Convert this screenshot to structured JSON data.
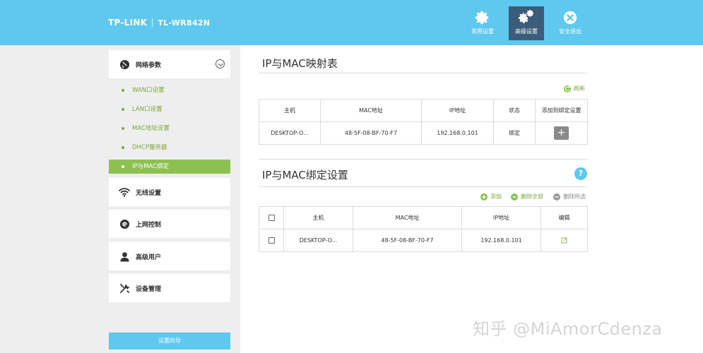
{
  "header": {
    "brand": "TP-LINK",
    "model": "TL-WR842N",
    "nav": [
      {
        "label": "常用设置",
        "icon": "gear-icon"
      },
      {
        "label": "高级设置",
        "icon": "gears-icon"
      },
      {
        "label": "安全退出",
        "icon": "close-circle-icon"
      }
    ],
    "active_nav": "高级设置"
  },
  "sidebar": {
    "network": {
      "label": "网络参数",
      "icon": "globe-icon"
    },
    "sub_items": [
      "WAN口设置",
      "LAN口设置",
      "MAC地址设置",
      "DHCP服务器",
      "IP与MAC绑定"
    ],
    "active_sub": "IP与MAC绑定",
    "wireless": {
      "label": "无线设置",
      "icon": "wifi-icon"
    },
    "internet": {
      "label": "上网控制",
      "icon": "internet-e-icon"
    },
    "admin_user": {
      "label": "高级用户",
      "icon": "user-icon"
    },
    "device": {
      "label": "设备管理",
      "icon": "tools-icon"
    },
    "wizard": "设置向导"
  },
  "mapping": {
    "title": "IP与MAC映射表",
    "refresh": "刷新",
    "headers": [
      "主机",
      "MAC地址",
      "IP地址",
      "状态",
      "添加到绑定设置"
    ],
    "rows": [
      {
        "host": "DESKTOP-O...",
        "mac": "48-5F-08-BF-70-F7",
        "ip": "192.168.0.101",
        "status": "绑定",
        "add": "+"
      }
    ]
  },
  "binding": {
    "title": "IP与MAC绑定设置",
    "help": "?",
    "actions": {
      "add": "添加",
      "delete_all": "删除全部",
      "delete_selected": "删除所选"
    },
    "headers": [
      "主机",
      "MAC地址",
      "IP地址",
      "编辑"
    ],
    "rows": [
      {
        "host": "DESKTOP-O...",
        "mac": "48-5F-08-BF-70-F7",
        "ip": "192.168.0.101"
      }
    ]
  },
  "watermark": "知乎 @MiAmorCdenza",
  "colors": {
    "header_bg": "#5ec8ee",
    "active_nav_bg": "#3b5d7a",
    "accent_green": "#8cc152",
    "sidebar_bg": "#eeeeee"
  }
}
